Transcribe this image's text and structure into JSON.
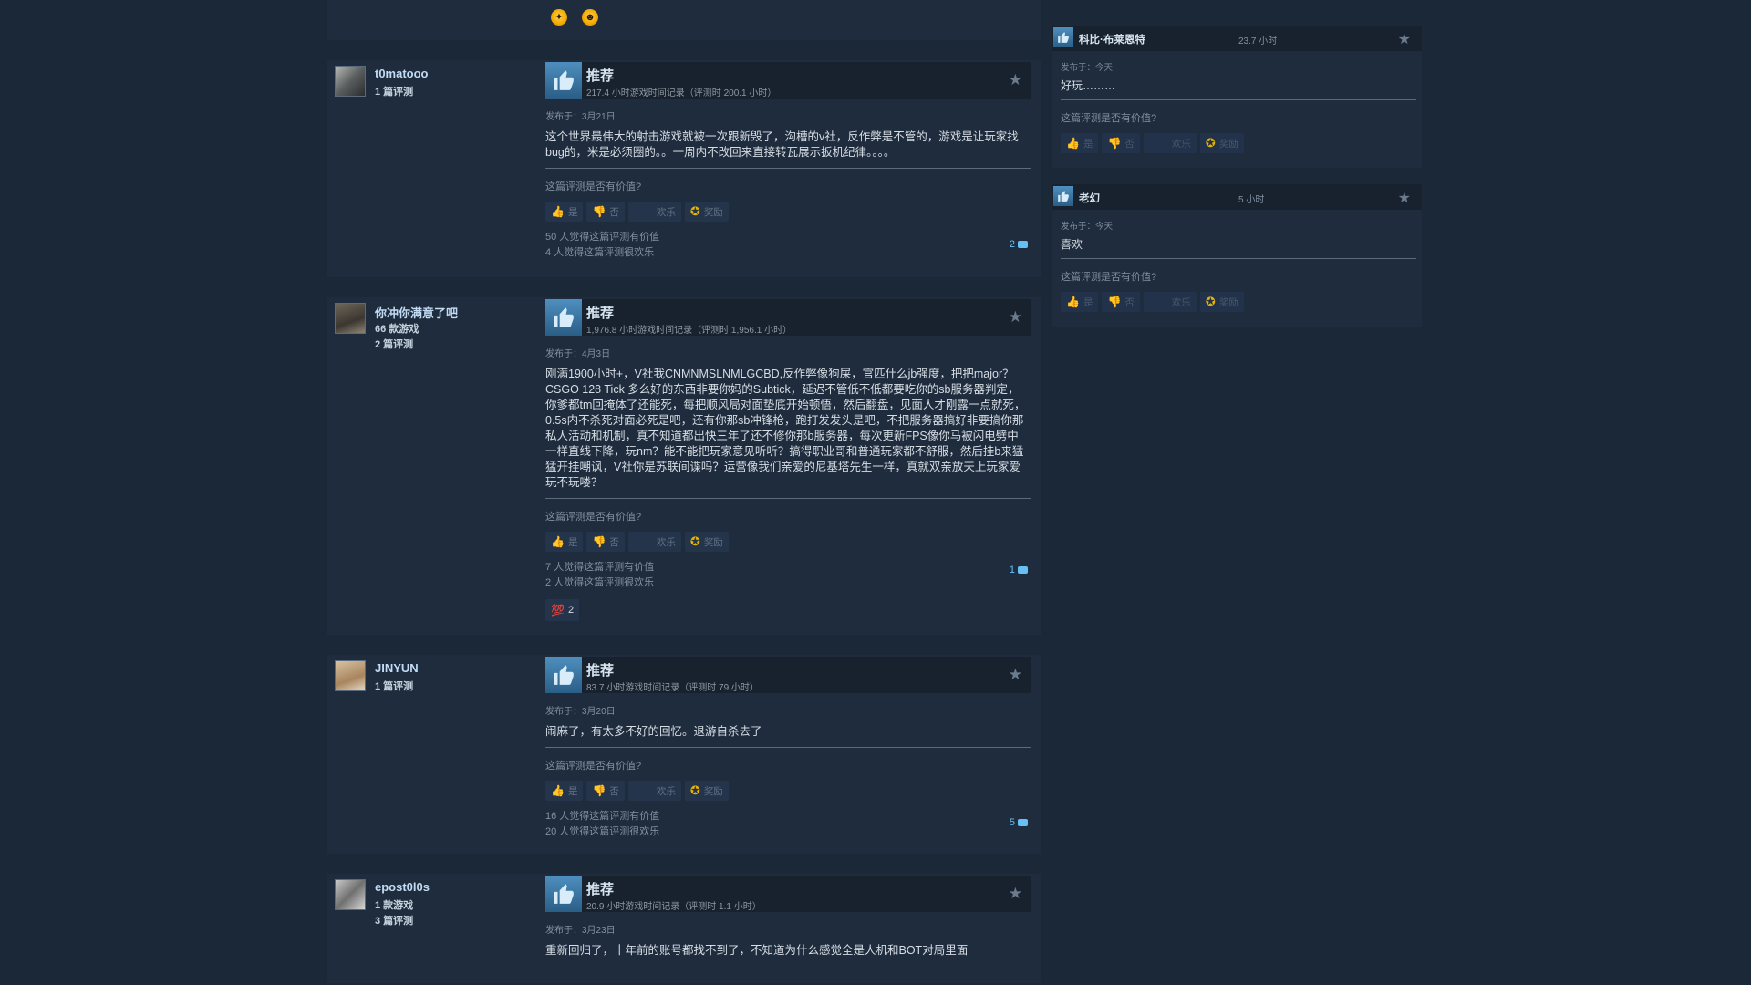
{
  "top_awards": [
    "award-gold-icon",
    "award-sunglasses-icon"
  ],
  "reviews": [
    {
      "name": "t0matooo",
      "stats": [
        "1 篇评测"
      ],
      "vote": "推荐",
      "hours": "217.4 小时游戏时间记录（评测时 200.1 小时）",
      "posted": "发布于：3月21日",
      "content": "这个世界最伟大的射击游戏就被一次跟新毁了，沟槽的v社，反作弊是不管的，游戏是让玩家找bug的，米是必须圈的。。一周内不改回来直接转瓦展示扳机纪律。。。。",
      "helpful_q": "这篇评测是否有价值?",
      "buttons": {
        "yes": "是",
        "no": "否",
        "funny": "欢乐",
        "award": "奖励"
      },
      "helpful": "50 人觉得这篇评测有价值",
      "funny": "4 人觉得这篇评测很欢乐",
      "comments": "2"
    },
    {
      "name": "你冲你满意了吧",
      "stats": [
        "66 款游戏",
        "2 篇评测"
      ],
      "vote": "推荐",
      "hours": "1,976.8 小时游戏时间记录（评测时 1,956.1 小时）",
      "posted": "发布于：4月3日",
      "content": "刚满1900小时+，V社我CNMNMSLNMLGCBD,反作弊像狗屎，官匹什么jb强度，把把major？CSGO 128 Tick 多么好的东西非要你妈的Subtick，延迟不管低不低都要吃你的sb服务器判定，你爹都tm回掩体了还能死，每把顺风局对面垫底开始顿悟，然后翻盘，见面人才刚露一点就死，0.5s内不杀死对面必死是吧，还有你那sb冲锋枪，跑打发发头是吧，不把服务器搞好非要搞你那私人活动和机制，真不知道都出快三年了还不修你那b服务器，每次更新FPS像你马被闪电劈中一样直线下降，玩nm？能不能把玩家意见听听？搞得职业哥和普通玩家都不舒服，然后挂b来猛猛开挂嘲讽，V社你是苏联间谍吗？运营像我们亲爱的尼基塔先生一样，真就双亲放天上玩家爱玩不玩喽？",
      "helpful_q": "这篇评测是否有价值?",
      "buttons": {
        "yes": "是",
        "no": "否",
        "funny": "欢乐",
        "award": "奖励"
      },
      "helpful": "7 人觉得这篇评测有价值",
      "funny": "2 人觉得这篇评测很欢乐",
      "comments": "1",
      "reaction": {
        "icon": "💯",
        "count": "2"
      }
    },
    {
      "name": "JINYUN",
      "stats": [
        "1 篇评测"
      ],
      "vote": "推荐",
      "hours": "83.7 小时游戏时间记录（评测时 79 小时）",
      "posted": "发布于：3月20日",
      "content": "闹麻了，有太多不好的回忆。退游自杀去了",
      "helpful_q": "这篇评测是否有价值?",
      "buttons": {
        "yes": "是",
        "no": "否",
        "funny": "欢乐",
        "award": "奖励"
      },
      "helpful": "16 人觉得这篇评测有价值",
      "funny": "20 人觉得这篇评测很欢乐",
      "comments": "5"
    },
    {
      "name": "epost0l0s",
      "stats": [
        "1 款游戏",
        "3 篇评测"
      ],
      "vote": "推荐",
      "hours": "20.9 小时游戏时间记录（评测时 1.1 小时）",
      "posted": "发布于：3月23日",
      "content": "重新回归了，十年前的账号都找不到了，不知道为什么感觉全是人机和BOT对局里面"
    }
  ],
  "side_reviews": [
    {
      "name": "科比·布莱恩特",
      "hours": "23.7 小时",
      "posted": "发布于：今天",
      "content": "好玩………",
      "helpful_q": "这篇评测是否有价值?",
      "buttons": {
        "yes": "是",
        "no": "否",
        "funny": "欢乐",
        "award": "奖励"
      }
    },
    {
      "name": "老幻",
      "hours": "5 小时",
      "posted": "发布于：今天",
      "content": "喜欢",
      "helpful_q": "这篇评测是否有价值?",
      "buttons": {
        "yes": "是",
        "no": "否",
        "funny": "欢乐",
        "award": "奖励"
      }
    }
  ],
  "colors": {
    "background": "#1b2838",
    "card": "#1f2c3d",
    "link": "#66c0f4",
    "thumb": "#4e8fbf"
  }
}
